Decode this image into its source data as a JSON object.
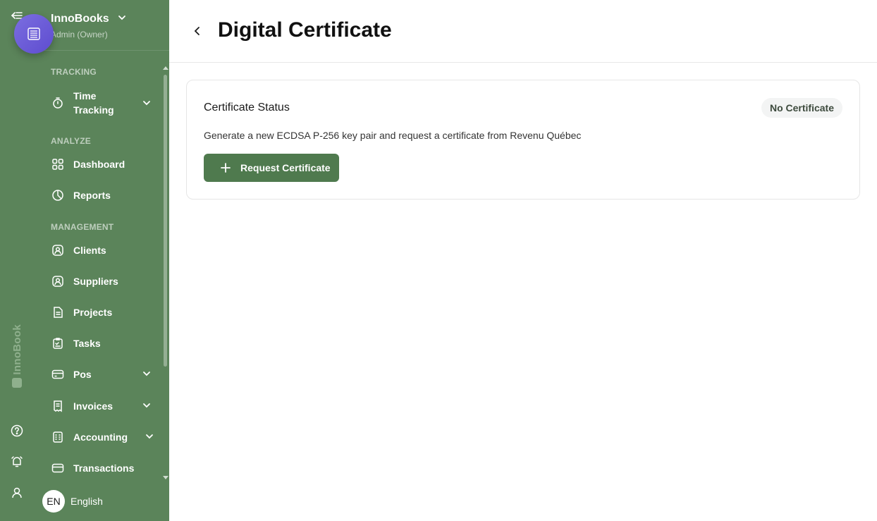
{
  "app": {
    "brand_vertical": "InnoBook"
  },
  "sidebar": {
    "org_name": "InnoBooks",
    "org_role": "Admin (Owner)",
    "sections": {
      "tracking": "TRACKING",
      "analyze": "ANALYZE",
      "management": "MANAGEMENT"
    },
    "items": [
      {
        "label": "Time",
        "label2": "Tracking",
        "icon": "stopwatch-icon",
        "has_chevron": true
      },
      {
        "label": "Dashboard",
        "icon": "grid-icon"
      },
      {
        "label": "Reports",
        "icon": "pie-chart-icon"
      },
      {
        "label": "Clients",
        "icon": "user-badge-icon"
      },
      {
        "label": "Suppliers",
        "icon": "user-badge-icon"
      },
      {
        "label": "Projects",
        "icon": "document-icon"
      },
      {
        "label": "Tasks",
        "icon": "clipboard-check-icon"
      },
      {
        "label": "Pos",
        "icon": "card-icon",
        "has_chevron": true
      },
      {
        "label": "Invoices",
        "icon": "receipt-icon",
        "has_chevron": true
      },
      {
        "label": "Accounting",
        "icon": "calculator-icon",
        "has_chevron": true
      },
      {
        "label": "Transactions",
        "icon": "card-icon"
      }
    ],
    "language": {
      "code": "EN",
      "name": "English"
    }
  },
  "main": {
    "title": "Digital Certificate",
    "card": {
      "title": "Certificate Status",
      "status": "No Certificate",
      "description": "Generate a new ECDSA P-256 key pair and request a certificate from Revenu Québec",
      "button_label": "Request Certificate"
    }
  },
  "colors": {
    "sidebar_bg": "#5b845a",
    "primary_button": "#4f7a4e",
    "fab_gradient_start": "#7b6ee0",
    "fab_gradient_end": "#5e4ccf"
  }
}
